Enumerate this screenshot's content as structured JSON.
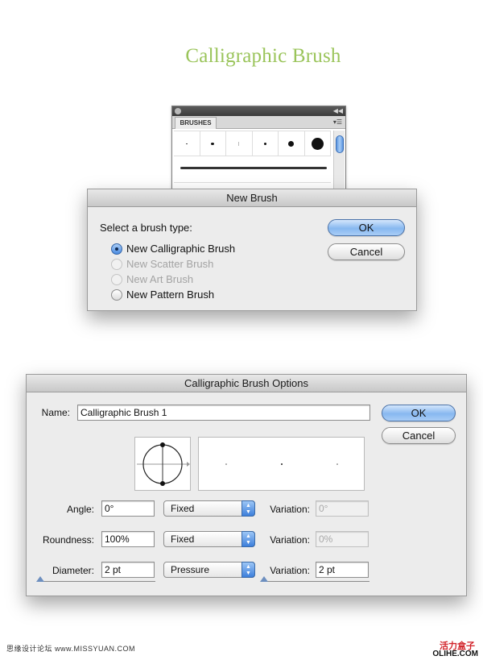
{
  "page_title": "Calligraphic Brush",
  "brushes_panel": {
    "tab_label": "BRUSHES",
    "menu_icon": "panel-menu-icon",
    "collapse_icon": "double-chevron-icon"
  },
  "new_brush_dialog": {
    "title": "New Brush",
    "prompt": "Select a brush type:",
    "options": [
      {
        "label": "New Calligraphic Brush",
        "state": "selected"
      },
      {
        "label": "New Scatter Brush",
        "state": "disabled"
      },
      {
        "label": "New Art Brush",
        "state": "disabled"
      },
      {
        "label": "New Pattern Brush",
        "state": "enabled"
      }
    ],
    "ok_label": "OK",
    "cancel_label": "Cancel"
  },
  "calligraphic_options": {
    "title": "Calligraphic Brush Options",
    "name_label": "Name:",
    "name_value": "Calligraphic Brush 1",
    "ok_label": "OK",
    "cancel_label": "Cancel",
    "rows": [
      {
        "label": "Angle:",
        "value": "0°",
        "mode": "Fixed",
        "variation_label": "Variation:",
        "variation": "0°",
        "variation_enabled": false
      },
      {
        "label": "Roundness:",
        "value": "100%",
        "mode": "Fixed",
        "variation_label": "Variation:",
        "variation": "0%",
        "variation_enabled": false
      },
      {
        "label": "Diameter:",
        "value": "2 pt",
        "mode": "Pressure",
        "variation_label": "Variation:",
        "variation": "2 pt",
        "variation_enabled": true
      }
    ]
  },
  "footer": {
    "left": "思缘设计论坛 www.MISSYUAN.COM",
    "right_cn": "活力盒子",
    "right_en": "OLIHE.COM"
  },
  "colors": {
    "title_green": "#9ac45a",
    "default_button_blue": "#87b8f0",
    "footer_red": "#d2232a"
  }
}
